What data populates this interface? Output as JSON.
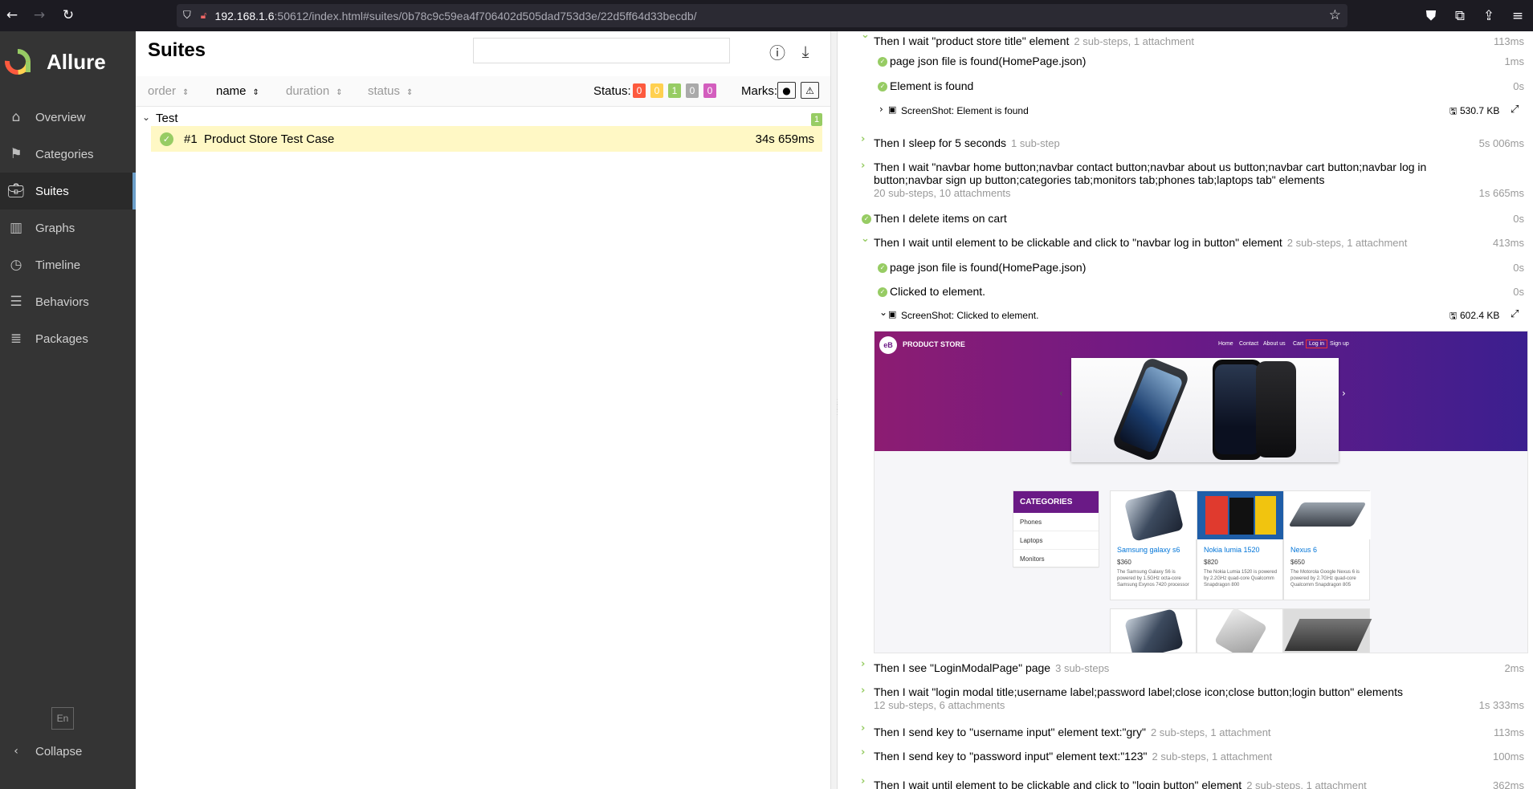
{
  "browser": {
    "url_host": "192.168.1.6",
    "url_rest": ":50612/index.html#suites/0b78c9c59ea4f706402d505dad753d3e/22d5ff64d33becdb/"
  },
  "sidebar": {
    "brand": "Allure",
    "items": [
      {
        "label": "Overview",
        "icon": "home-icon"
      },
      {
        "label": "Categories",
        "icon": "flag-icon"
      },
      {
        "label": "Suites",
        "icon": "briefcase-icon"
      },
      {
        "label": "Graphs",
        "icon": "bar-chart-icon"
      },
      {
        "label": "Timeline",
        "icon": "clock-icon"
      },
      {
        "label": "Behaviors",
        "icon": "list-icon"
      },
      {
        "label": "Packages",
        "icon": "align-left-icon"
      }
    ],
    "active": "Suites",
    "lang": "En",
    "collapse": "Collapse"
  },
  "suites": {
    "title": "Suites",
    "sort": {
      "order": "order",
      "name": "name",
      "duration": "duration",
      "status": "status"
    },
    "status_label": "Status:",
    "status_counts": [
      {
        "value": "0",
        "color": "#fd5a3e"
      },
      {
        "value": "0",
        "color": "#ffd050"
      },
      {
        "value": "1",
        "color": "#97cc64"
      },
      {
        "value": "0",
        "color": "#aaaaaa"
      },
      {
        "value": "0",
        "color": "#d35ebe"
      }
    ],
    "marks_label": "Marks:",
    "group": {
      "name": "Test",
      "count": "1"
    },
    "case": {
      "number": "#1",
      "title": "Product Store Test Case",
      "duration": "34s 659ms"
    }
  },
  "steps": [
    {
      "text": "Then I wait \"product store title\" element",
      "meta": "2 sub-steps, 1 attachment",
      "time": "113ms"
    },
    {
      "text": "page json file is found(HomePage.json)",
      "time": "1ms"
    },
    {
      "text": "Element is found",
      "time": "0s"
    },
    {
      "text": "ScreenShot: Element is found",
      "size": "530.7 KB"
    },
    {
      "text": "Then I sleep for 5 seconds",
      "meta": "1 sub-step",
      "time": "5s 006ms"
    },
    {
      "text": "Then I wait \"navbar home button;navbar contact button;navbar about us button;navbar cart button;navbar log in",
      "text2": "button;navbar sign up button;categories tab;monitors tab;phones tab;laptops tab\" elements",
      "meta": "20 sub-steps, 10 attachments",
      "time": "1s 665ms"
    },
    {
      "text": "Then I delete items on cart",
      "time": "0s"
    },
    {
      "text": "Then I wait until element to be clickable and click to \"navbar log in button\" element",
      "meta": "2 sub-steps, 1 attachment",
      "time": "413ms"
    },
    {
      "text": "page json file is found(HomePage.json)",
      "time": "0s"
    },
    {
      "text": "Clicked to element.",
      "time": "0s"
    },
    {
      "text": "ScreenShot: Clicked to element.",
      "size": "602.4 KB"
    },
    {
      "text": "Then I see \"LoginModalPage\" page",
      "meta": "3 sub-steps",
      "time": "2ms"
    },
    {
      "text": "Then I wait \"login modal title;username label;password label;close icon;close button;login button\" elements",
      "meta": "12 sub-steps, 6 attachments",
      "time": "1s 333ms"
    },
    {
      "text": "Then I send key to \"username input\" element text:\"gry\"",
      "meta": "2 sub-steps, 1 attachment",
      "time": "113ms"
    },
    {
      "text": "Then I send key to \"password input\" element text:\"123\"",
      "meta": "2 sub-steps, 1 attachment",
      "time": "100ms"
    },
    {
      "text": "Then I wait until element to be clickable and click to \"login button\" element",
      "meta": "2 sub-steps, 1 attachment",
      "time": "362ms"
    }
  ],
  "screenshot": {
    "brand": "PRODUCT STORE",
    "nav": [
      "Home",
      "Contact",
      "About us",
      "Cart",
      "Log in",
      "Sign up"
    ],
    "categories_title": "CATEGORIES",
    "categories": [
      "Phones",
      "Laptops",
      "Monitors"
    ],
    "products": [
      {
        "name": "Samsung galaxy s6",
        "price": "$360",
        "desc": "The Samsung Galaxy S6 is powered by 1.5GHz octa-core Samsung Exynos 7420 processor"
      },
      {
        "name": "Nokia lumia 1520",
        "price": "$820",
        "desc": "The Nokia Lumia 1520 is powered by 2.2GHz quad-core Qualcomm Snapdragon 800"
      },
      {
        "name": "Nexus 6",
        "price": "$650",
        "desc": "The Motorola Google Nexus 6 is powered by 2.7GHz quad-core Qualcomm Snapdragon 805"
      }
    ]
  }
}
